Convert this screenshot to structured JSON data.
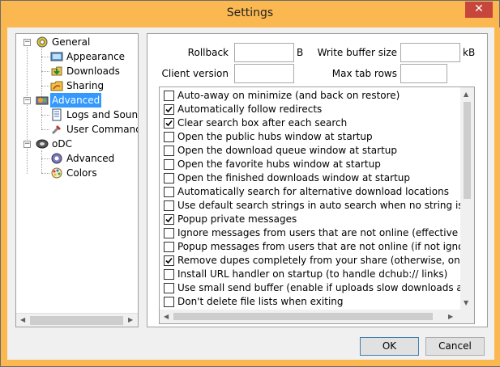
{
  "window": {
    "title": "Settings",
    "close_glyph": "✕"
  },
  "tree": {
    "items": [
      {
        "label": "General",
        "icon": "general-icon",
        "selected": false
      },
      {
        "label": "Appearance",
        "icon": "appearance-icon",
        "selected": false
      },
      {
        "label": "Downloads",
        "icon": "downloads-icon",
        "selected": false
      },
      {
        "label": "Sharing",
        "icon": "sharing-icon",
        "selected": false
      },
      {
        "label": "Advanced",
        "icon": "advanced-icon",
        "selected": true
      },
      {
        "label": "Logs and Sound",
        "icon": "logs-icon",
        "selected": false
      },
      {
        "label": "User Command",
        "icon": "user-command-icon",
        "selected": false
      },
      {
        "label": "oDC",
        "icon": "odc-icon",
        "selected": false
      },
      {
        "label": "Advanced",
        "icon": "odc-advanced-icon",
        "selected": false
      },
      {
        "label": "Colors",
        "icon": "colors-icon",
        "selected": false
      }
    ]
  },
  "fields": {
    "rollback_label": "Rollback",
    "rollback_value": "",
    "rollback_unit": "B",
    "write_buffer_label": "Write buffer size",
    "write_buffer_value": "",
    "write_buffer_unit": "kB",
    "client_version_label": "Client version",
    "client_version_value": "",
    "max_tab_rows_label": "Max tab rows",
    "max_tab_rows_value": ""
  },
  "options": [
    {
      "label": "Auto-away on minimize (and back on restore)",
      "checked": false
    },
    {
      "label": "Automatically follow redirects",
      "checked": true
    },
    {
      "label": "Clear search box after each search",
      "checked": true
    },
    {
      "label": "Open the public hubs window at startup",
      "checked": false
    },
    {
      "label": "Open the download queue window at startup",
      "checked": false
    },
    {
      "label": "Open the favorite hubs window at startup",
      "checked": false
    },
    {
      "label": "Open the finished downloads window at startup",
      "checked": false
    },
    {
      "label": "Automatically search for alternative download locations",
      "checked": false
    },
    {
      "label": "Use default search strings in auto search when no string is specified",
      "checked": false
    },
    {
      "label": "Popup private messages",
      "checked": true
    },
    {
      "label": "Ignore messages from users that are not online (effective against bots)",
      "checked": false
    },
    {
      "label": "Popup messages from users that are not online (if not ignoring, messages",
      "checked": false
    },
    {
      "label": "Remove dupes completely from your share (otherwise, only their size is s",
      "checked": true
    },
    {
      "label": "Install URL handler on startup (to handle dchub:// links)",
      "checked": false
    },
    {
      "label": "Use small send buffer (enable if uploads slow downloads a lot)",
      "checked": false
    },
    {
      "label": "Don't delete file lists when exiting",
      "checked": false
    }
  ],
  "buttons": {
    "ok": "OK",
    "cancel": "Cancel"
  },
  "colors": {
    "titlebar": "#fbb850",
    "selection": "#3399ff",
    "close": "#c7463c"
  }
}
